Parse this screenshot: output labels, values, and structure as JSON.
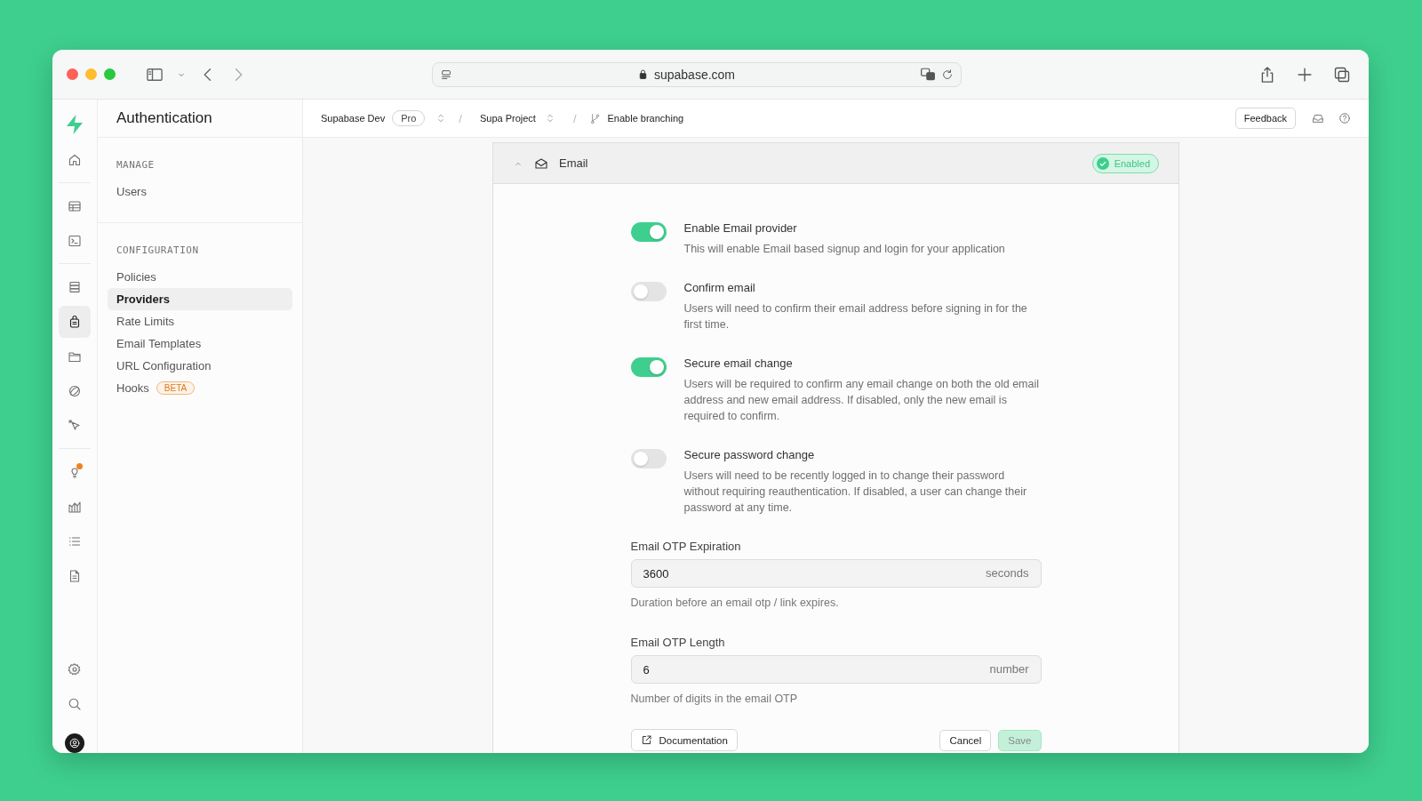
{
  "browser": {
    "url": "supabase.com"
  },
  "rail": {
    "top": [
      {
        "selected": false,
        "notification": false
      },
      {
        "selected": false,
        "notification": false
      },
      {
        "selected": false,
        "notification": false
      },
      {
        "selected": false,
        "notification": false
      },
      {
        "selected": true,
        "notification": false
      },
      {
        "selected": false,
        "notification": false
      },
      {
        "selected": false,
        "notification": false
      },
      {
        "selected": false,
        "notification": false
      },
      {
        "selected": false,
        "notification": true
      },
      {
        "selected": false,
        "notification": false
      },
      {
        "selected": false,
        "notification": false
      },
      {
        "selected": false,
        "notification": false
      }
    ],
    "bottom": [
      {
        "selected": false
      },
      {
        "selected": false
      }
    ]
  },
  "sidebar": {
    "title": "Authentication",
    "sections": [
      {
        "heading": "MANAGE",
        "items": [
          {
            "label": "Users",
            "selected": false
          }
        ]
      },
      {
        "heading": "CONFIGURATION",
        "items": [
          {
            "label": "Policies",
            "selected": false
          },
          {
            "label": "Providers",
            "selected": true
          },
          {
            "label": "Rate Limits",
            "selected": false
          },
          {
            "label": "Email Templates",
            "selected": false
          },
          {
            "label": "URL Configuration",
            "selected": false
          },
          {
            "label": "Hooks",
            "selected": false,
            "badge": "BETA"
          }
        ]
      }
    ]
  },
  "topbar": {
    "organization": "Supabase Dev",
    "plan": "Pro",
    "separator_1": "/",
    "project": "Supa Project",
    "separator_2": "/",
    "branch": "Enable branching",
    "feedback": "Feedback"
  },
  "card": {
    "title": "Email",
    "status": "Enabled",
    "toggles": [
      {
        "label": "Enable Email provider",
        "description": "This will enable Email based signup and login for your application",
        "on": true
      },
      {
        "label": "Confirm email",
        "description": "Users will need to confirm their email address before signing in for the first time.",
        "on": false
      },
      {
        "label": "Secure email change",
        "description": "Users will be required to confirm any email change on both the old email address and new email address. If disabled, only the new email is required to confirm.",
        "on": true
      },
      {
        "label": "Secure password change",
        "description": "Users will need to be recently logged in to change their password without requiring reauthentication. If disabled, a user can change their password at any time.",
        "on": false
      }
    ],
    "fields": [
      {
        "label": "Email OTP Expiration",
        "value": "3600",
        "unit": "seconds",
        "help": "Duration before an email otp / link expires."
      },
      {
        "label": "Email OTP Length",
        "value": "6",
        "unit": "number",
        "help": "Number of digits in the email OTP"
      }
    ],
    "documentation": "Documentation",
    "cancel": "Cancel",
    "save": {
      "label": "Save",
      "disabled": true
    }
  }
}
